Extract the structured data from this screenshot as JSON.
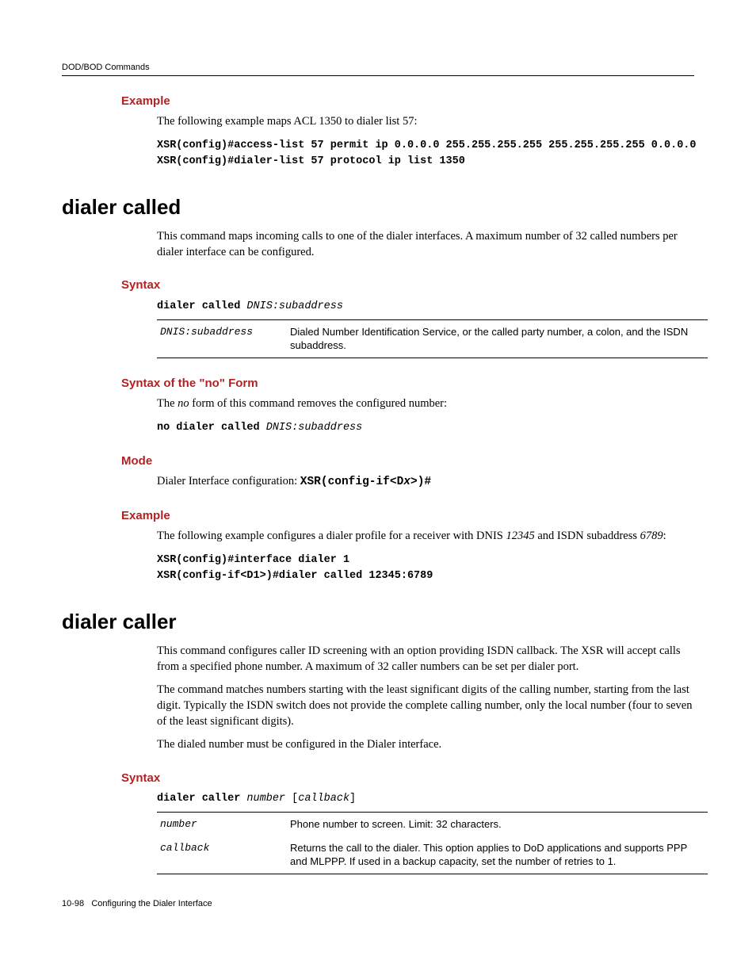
{
  "header": {
    "running": "DOD/BOD Commands"
  },
  "sec1": {
    "example_head": "Example",
    "example_intro": "The following example maps ACL 1350 to dialer list 57:",
    "example_code": "XSR(config)#access-list 57 permit ip 0.0.0.0 255.255.255.255 255.255.255.255 0.0.0.0\nXSR(config)#dialer-list 57 protocol ip list 1350"
  },
  "cmd1": {
    "title": "dialer called",
    "desc": "This command maps incoming calls to one of the dialer interfaces. A maximum number of 32 called numbers per dialer interface can be configured.",
    "syntax_head": "Syntax",
    "syntax_cmd_bold": "dialer called ",
    "syntax_cmd_ital": "DNIS:subaddress",
    "param": {
      "name": "DNIS:subaddress",
      "desc": "Dialed Number Identification Service, or the called party number, a colon, and the ISDN subaddress."
    },
    "noform_head": "Syntax of the \"no\" Form",
    "noform_intro_a": "The ",
    "noform_intro_b": "no",
    "noform_intro_c": " form of this command removes the configured number:",
    "noform_code_bold": "no dialer called ",
    "noform_code_ital": "DNIS:subaddress",
    "mode_head": "Mode",
    "mode_text": "Dialer Interface configuration: ",
    "mode_prompt_a": "XSR(config-if<D",
    "mode_prompt_b": "x",
    "mode_prompt_c": ">)#",
    "example_head": "Example",
    "example_intro_a": "The following example configures a dialer profile for a receiver with DNIS ",
    "example_intro_b": "12345",
    "example_intro_c": " and ISDN subaddress ",
    "example_intro_d": "6789",
    "example_intro_e": ":",
    "example_code": "XSR(config)#interface dialer 1\nXSR(config-if<D1>)#dialer called 12345:6789"
  },
  "cmd2": {
    "title": "dialer caller",
    "desc1": "This command configures caller ID screening with an option providing ISDN callback. The XSR will accept calls from a specified phone number. A maximum of 32 caller numbers can be set per dialer port.",
    "desc2": "The command matches numbers starting with the least significant digits of the calling number, starting from the last digit. Typically the ISDN switch does not provide the complete calling number, only the local number (four to seven of the least significant digits).",
    "desc3": "The dialed number must be configured in the Dialer interface.",
    "syntax_head": "Syntax",
    "syntax_cmd_bold": "dialer caller ",
    "syntax_cmd_ital1": "number",
    "syntax_cmd_lit1": " [",
    "syntax_cmd_ital2": "callback",
    "syntax_cmd_lit2": "]",
    "params": [
      {
        "name": "number",
        "desc": "Phone number to screen. Limit: 32 characters."
      },
      {
        "name": "callback",
        "desc": "Returns the call to the dialer. This option applies to DoD applications and supports PPP and MLPPP. If used in a backup capacity, set the number of retries to 1."
      }
    ]
  },
  "footer": {
    "page": "10-98",
    "title": "Configuring the Dialer Interface"
  }
}
